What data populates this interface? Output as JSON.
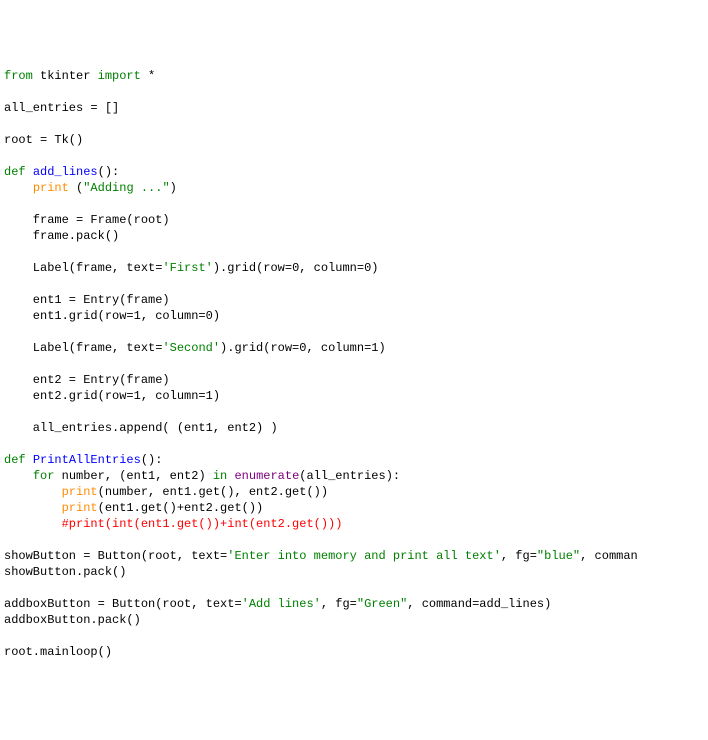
{
  "tokens": [
    {
      "cls": "kw",
      "t": "from"
    },
    {
      "cls": "plain",
      "t": " tkinter "
    },
    {
      "cls": "kw",
      "t": "import"
    },
    {
      "cls": "plain",
      "t": " *"
    },
    {
      "cls": "plain",
      "t": "\n"
    },
    {
      "cls": "plain",
      "t": "\n"
    },
    {
      "cls": "plain",
      "t": "all_entries = []"
    },
    {
      "cls": "plain",
      "t": "\n"
    },
    {
      "cls": "plain",
      "t": "\n"
    },
    {
      "cls": "plain",
      "t": "root = Tk()"
    },
    {
      "cls": "plain",
      "t": "\n"
    },
    {
      "cls": "plain",
      "t": "\n"
    },
    {
      "cls": "kw",
      "t": "def"
    },
    {
      "cls": "plain",
      "t": " "
    },
    {
      "cls": "nm",
      "t": "add_lines"
    },
    {
      "cls": "plain",
      "t": "():"
    },
    {
      "cls": "plain",
      "t": "\n"
    },
    {
      "cls": "plain",
      "t": "    "
    },
    {
      "cls": "call",
      "t": "print"
    },
    {
      "cls": "plain",
      "t": " ("
    },
    {
      "cls": "str",
      "t": "\"Adding ...\""
    },
    {
      "cls": "plain",
      "t": ")"
    },
    {
      "cls": "plain",
      "t": "\n"
    },
    {
      "cls": "plain",
      "t": "\n"
    },
    {
      "cls": "plain",
      "t": "    frame = Frame(root)"
    },
    {
      "cls": "plain",
      "t": "\n"
    },
    {
      "cls": "plain",
      "t": "    frame.pack()"
    },
    {
      "cls": "plain",
      "t": "\n"
    },
    {
      "cls": "plain",
      "t": "\n"
    },
    {
      "cls": "plain",
      "t": "    Label(frame, text="
    },
    {
      "cls": "str",
      "t": "'First'"
    },
    {
      "cls": "plain",
      "t": ").grid(row=0, column=0)"
    },
    {
      "cls": "plain",
      "t": "\n"
    },
    {
      "cls": "plain",
      "t": "\n"
    },
    {
      "cls": "plain",
      "t": "    ent1 = Entry(frame)"
    },
    {
      "cls": "plain",
      "t": "\n"
    },
    {
      "cls": "plain",
      "t": "    ent1.grid(row=1, column=0)"
    },
    {
      "cls": "plain",
      "t": "\n"
    },
    {
      "cls": "plain",
      "t": "\n"
    },
    {
      "cls": "plain",
      "t": "    Label(frame, text="
    },
    {
      "cls": "str",
      "t": "'Second'"
    },
    {
      "cls": "plain",
      "t": ").grid(row=0, column=1)"
    },
    {
      "cls": "plain",
      "t": "\n"
    },
    {
      "cls": "plain",
      "t": "\n"
    },
    {
      "cls": "plain",
      "t": "    ent2 = Entry(frame)"
    },
    {
      "cls": "plain",
      "t": "\n"
    },
    {
      "cls": "plain",
      "t": "    ent2.grid(row=1, column=1)"
    },
    {
      "cls": "plain",
      "t": "\n"
    },
    {
      "cls": "plain",
      "t": "\n"
    },
    {
      "cls": "plain",
      "t": "    all_entries.append( (ent1, ent2) )"
    },
    {
      "cls": "plain",
      "t": "\n"
    },
    {
      "cls": "plain",
      "t": "\n"
    },
    {
      "cls": "kw",
      "t": "def"
    },
    {
      "cls": "plain",
      "t": " "
    },
    {
      "cls": "nm",
      "t": "PrintAllEntries"
    },
    {
      "cls": "plain",
      "t": "():"
    },
    {
      "cls": "plain",
      "t": "\n"
    },
    {
      "cls": "plain",
      "t": "    "
    },
    {
      "cls": "kw",
      "t": "for"
    },
    {
      "cls": "plain",
      "t": " number, (ent1, ent2) "
    },
    {
      "cls": "kw",
      "t": "in"
    },
    {
      "cls": "plain",
      "t": " "
    },
    {
      "cls": "builtin",
      "t": "enumerate"
    },
    {
      "cls": "plain",
      "t": "(all_entries):"
    },
    {
      "cls": "plain",
      "t": "\n"
    },
    {
      "cls": "plain",
      "t": "        "
    },
    {
      "cls": "call",
      "t": "print"
    },
    {
      "cls": "plain",
      "t": "(number, ent1.get(), ent2.get())"
    },
    {
      "cls": "plain",
      "t": "\n"
    },
    {
      "cls": "plain",
      "t": "        "
    },
    {
      "cls": "call",
      "t": "print"
    },
    {
      "cls": "plain",
      "t": "(ent1.get()+ent2.get())"
    },
    {
      "cls": "plain",
      "t": "\n"
    },
    {
      "cls": "plain",
      "t": "        "
    },
    {
      "cls": "comment",
      "t": "#print(int(ent1.get())+int(ent2.get()))"
    },
    {
      "cls": "plain",
      "t": "\n"
    },
    {
      "cls": "plain",
      "t": "\n"
    },
    {
      "cls": "plain",
      "t": "showButton = Button(root, text="
    },
    {
      "cls": "str",
      "t": "'Enter into memory and print all text'"
    },
    {
      "cls": "plain",
      "t": ", fg="
    },
    {
      "cls": "str",
      "t": "\"blue\""
    },
    {
      "cls": "plain",
      "t": ", comman"
    },
    {
      "cls": "plain",
      "t": "\n"
    },
    {
      "cls": "plain",
      "t": "showButton.pack()"
    },
    {
      "cls": "plain",
      "t": "\n"
    },
    {
      "cls": "plain",
      "t": "\n"
    },
    {
      "cls": "plain",
      "t": "addboxButton = Button(root, text="
    },
    {
      "cls": "str",
      "t": "'Add lines'"
    },
    {
      "cls": "plain",
      "t": ", fg="
    },
    {
      "cls": "str",
      "t": "\"Green\""
    },
    {
      "cls": "plain",
      "t": ", command=add_lines)"
    },
    {
      "cls": "plain",
      "t": "\n"
    },
    {
      "cls": "plain",
      "t": "addboxButton.pack()"
    },
    {
      "cls": "plain",
      "t": "\n"
    },
    {
      "cls": "plain",
      "t": "\n"
    },
    {
      "cls": "plain",
      "t": "root.mainloop()"
    }
  ]
}
